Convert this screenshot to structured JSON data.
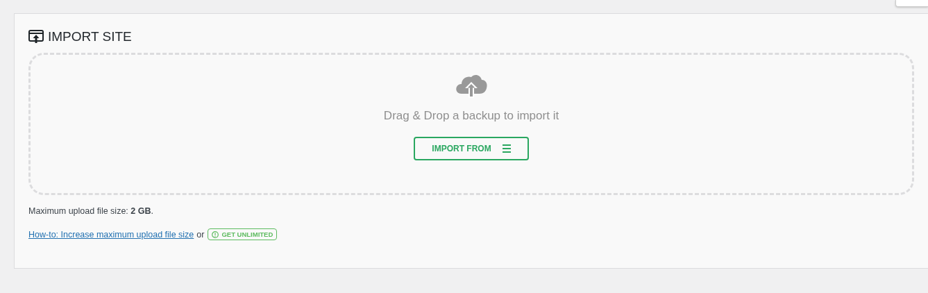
{
  "panel": {
    "title": "IMPORT SITE"
  },
  "dropzone": {
    "message": "Drag & Drop a backup to import it",
    "button": "IMPORT FROM"
  },
  "limit_note": "Maximum upload file size: **2 GB**.",
  "help": {
    "link": "How-to: Increase maximum upload file size",
    "separator": "or",
    "badge": "GET UNLIMITED"
  }
}
